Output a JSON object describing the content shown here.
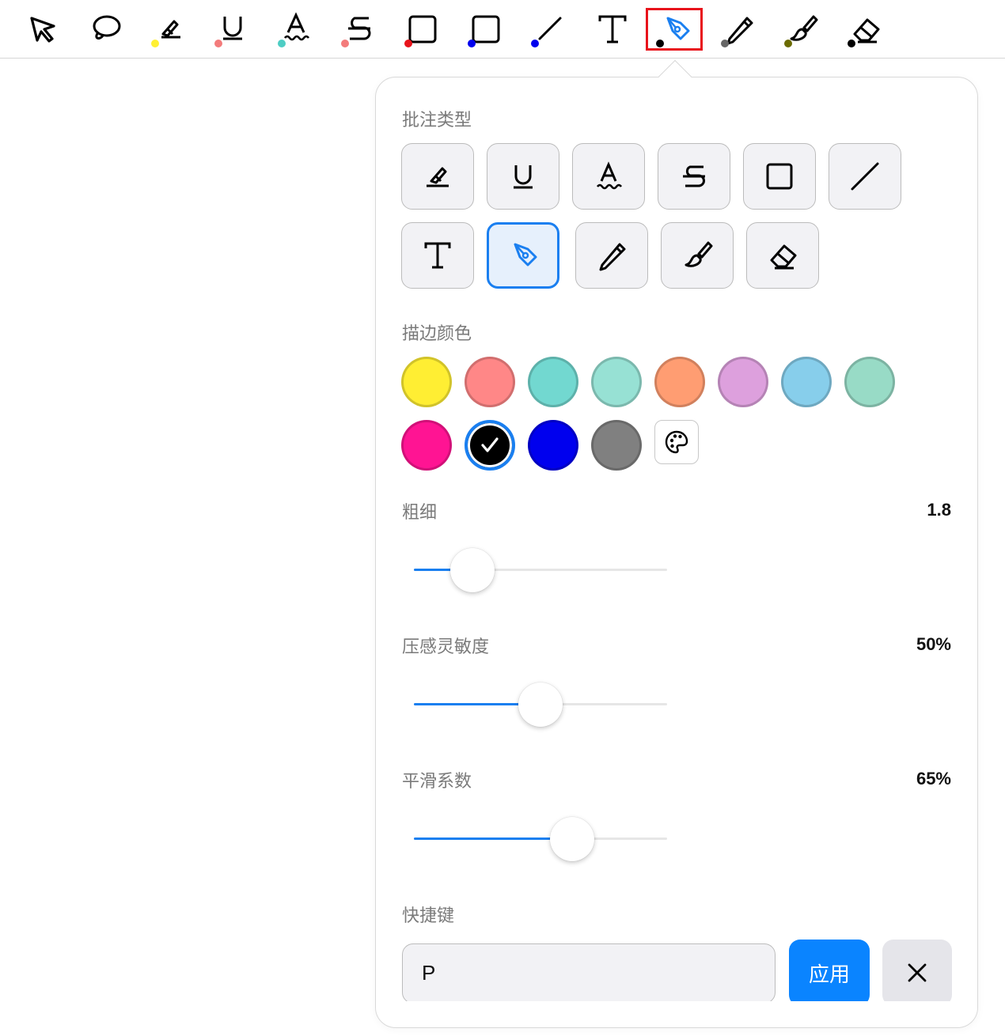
{
  "toolbar": {
    "tools": [
      {
        "name": "select",
        "icon": "cursor-arrow-icon",
        "dot": ""
      },
      {
        "name": "lasso",
        "icon": "lasso-icon",
        "dot": ""
      },
      {
        "name": "highlight",
        "icon": "highlighter-icon",
        "dot": "#fff033"
      },
      {
        "name": "underline",
        "icon": "underline-icon",
        "dot": "#f37b7b"
      },
      {
        "name": "squiggly",
        "icon": "squiggly-text-icon",
        "dot": "#4ecdc4"
      },
      {
        "name": "strikeout",
        "icon": "strikethrough-icon",
        "dot": "#f37b7b"
      },
      {
        "name": "rectangle",
        "icon": "rectangle-icon",
        "dot": "#e8131b"
      },
      {
        "name": "rectangle-blue",
        "icon": "rectangle-icon",
        "dot": "#0000ee"
      },
      {
        "name": "line",
        "icon": "line-icon",
        "dot": "#0000ee"
      },
      {
        "name": "text",
        "icon": "text-icon",
        "dot": ""
      },
      {
        "name": "pen",
        "icon": "pen-nib-icon",
        "dot": "#000000",
        "selected": true
      },
      {
        "name": "pencil",
        "icon": "pencil-icon",
        "dot": "#666666"
      },
      {
        "name": "brush",
        "icon": "brush-icon",
        "dot": "#6b6b00"
      },
      {
        "name": "eraser",
        "icon": "eraser-icon",
        "dot": "#000000"
      }
    ]
  },
  "panel": {
    "annotation_type_label": "批注类型",
    "annotation_types": [
      {
        "name": "highlight",
        "icon": "highlighter-icon"
      },
      {
        "name": "underline",
        "icon": "underline-icon"
      },
      {
        "name": "squiggly",
        "icon": "squiggly-text-icon"
      },
      {
        "name": "strikeout",
        "icon": "strikethrough-icon"
      },
      {
        "name": "rectangle",
        "icon": "rectangle-icon"
      },
      {
        "name": "line",
        "icon": "line-icon"
      },
      {
        "name": "text",
        "icon": "text-icon"
      },
      {
        "name": "pen",
        "icon": "pen-nib-icon",
        "active": true
      },
      {
        "name": "pencil",
        "icon": "pencil-icon"
      },
      {
        "name": "brush",
        "icon": "brush-icon"
      },
      {
        "name": "eraser",
        "icon": "eraser-icon"
      }
    ],
    "stroke_color_label": "描边颜色",
    "colors": [
      "#ffee33",
      "#ff8787",
      "#72d8d0",
      "#97e1d4",
      "#ff9d72",
      "#dda0dd",
      "#87ceeb",
      "#98dbc6",
      "#ff1493",
      "#000000",
      "#0000ee",
      "#808080"
    ],
    "selected_color": "#000000",
    "custom_color_icon": "palette-icon",
    "thickness_label": "粗细",
    "thickness_value": "1.8",
    "thickness_level": 0.23,
    "pressure_label": "压感灵敏度",
    "pressure_value": "50%",
    "pressure_level": 0.5,
    "smoothing_label": "平滑系数",
    "smoothing_value": "65%",
    "smoothing_level": 0.625,
    "shortcut_label": "快捷键",
    "shortcut_value": "P",
    "apply_label": "应用",
    "accent": "#0a84ff"
  }
}
